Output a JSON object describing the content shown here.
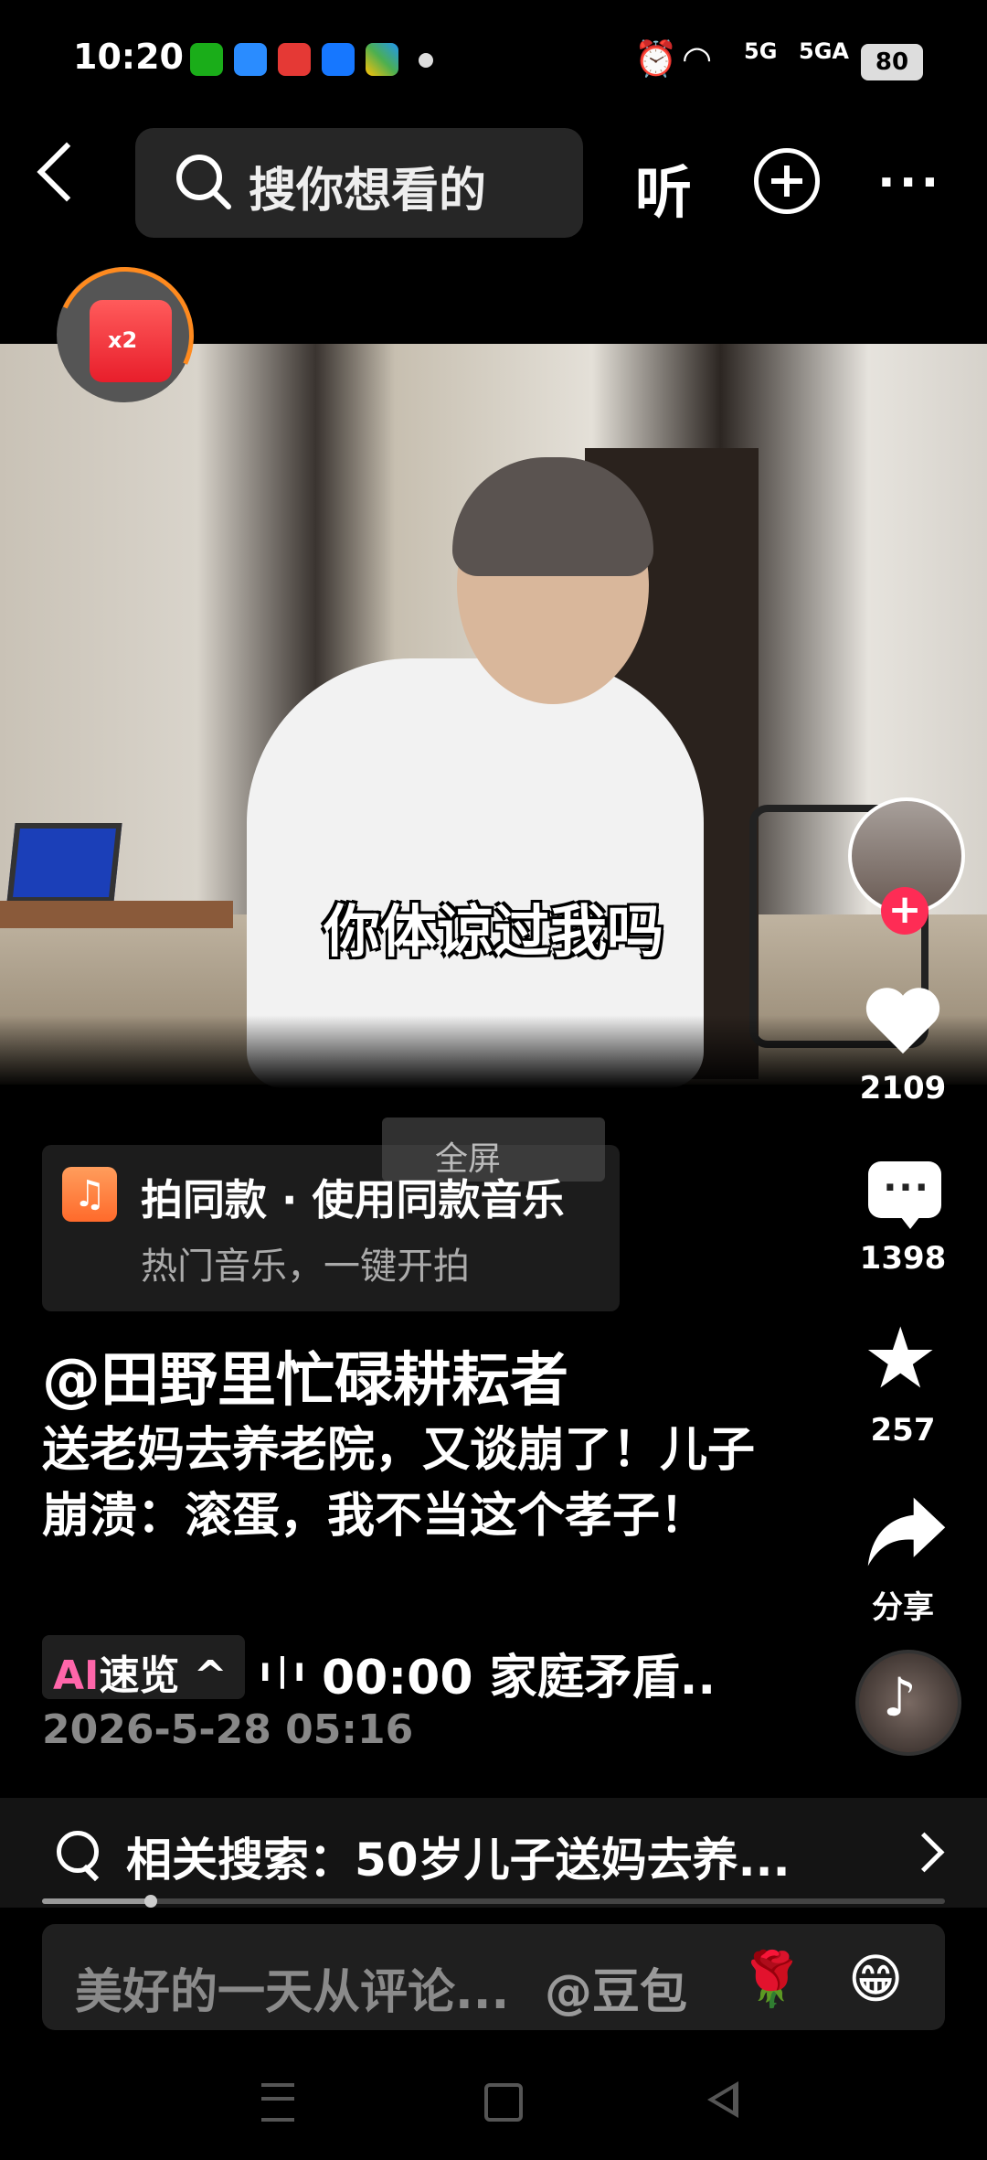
{
  "status_bar": {
    "time": "10:20",
    "app_icons": [
      "wechat-icon",
      "browser-icon",
      "toutiao-icon",
      "alipay-icon",
      "gallery-icon"
    ],
    "network_1": "5G",
    "network_2": "5GA",
    "battery": "80"
  },
  "top_nav": {
    "search_placeholder": "搜你想看的",
    "listen_label": "听"
  },
  "red_packet": {
    "label": "x2"
  },
  "video": {
    "subtitle": "你体谅过我吗"
  },
  "fullscreen_label": "全屏",
  "sidebar": {
    "likes": "2109",
    "comments": "1398",
    "favorites": "257",
    "share_label": "分享"
  },
  "music_card": {
    "title": "拍同款 · 使用同款音乐",
    "subtitle": "热门音乐，一键开拍"
  },
  "post": {
    "author": "@田野里忙碌耕耘者",
    "description": "送老妈去养老院，又谈崩了！儿子崩溃：滚蛋，我不当这个孝子！",
    "ai_prefix": "AI",
    "ai_label": "速览",
    "ai_chevron": "^",
    "ai_summary": "00:00 家庭矛盾..",
    "date": "2026-5-28 05:16"
  },
  "related_search": {
    "text": "相关搜索：50岁儿子送妈去养..."
  },
  "progress": {
    "fraction": 0.12
  },
  "comment_bar": {
    "placeholder": "美好的一天从评论...",
    "mention": "@豆包",
    "emoji_1": "🌹",
    "emoji_2": "😁"
  },
  "colors": {
    "accent_red": "#fe2c55",
    "ring_orange": "#ff8a1e",
    "music_orange": "#ff7a3a"
  }
}
